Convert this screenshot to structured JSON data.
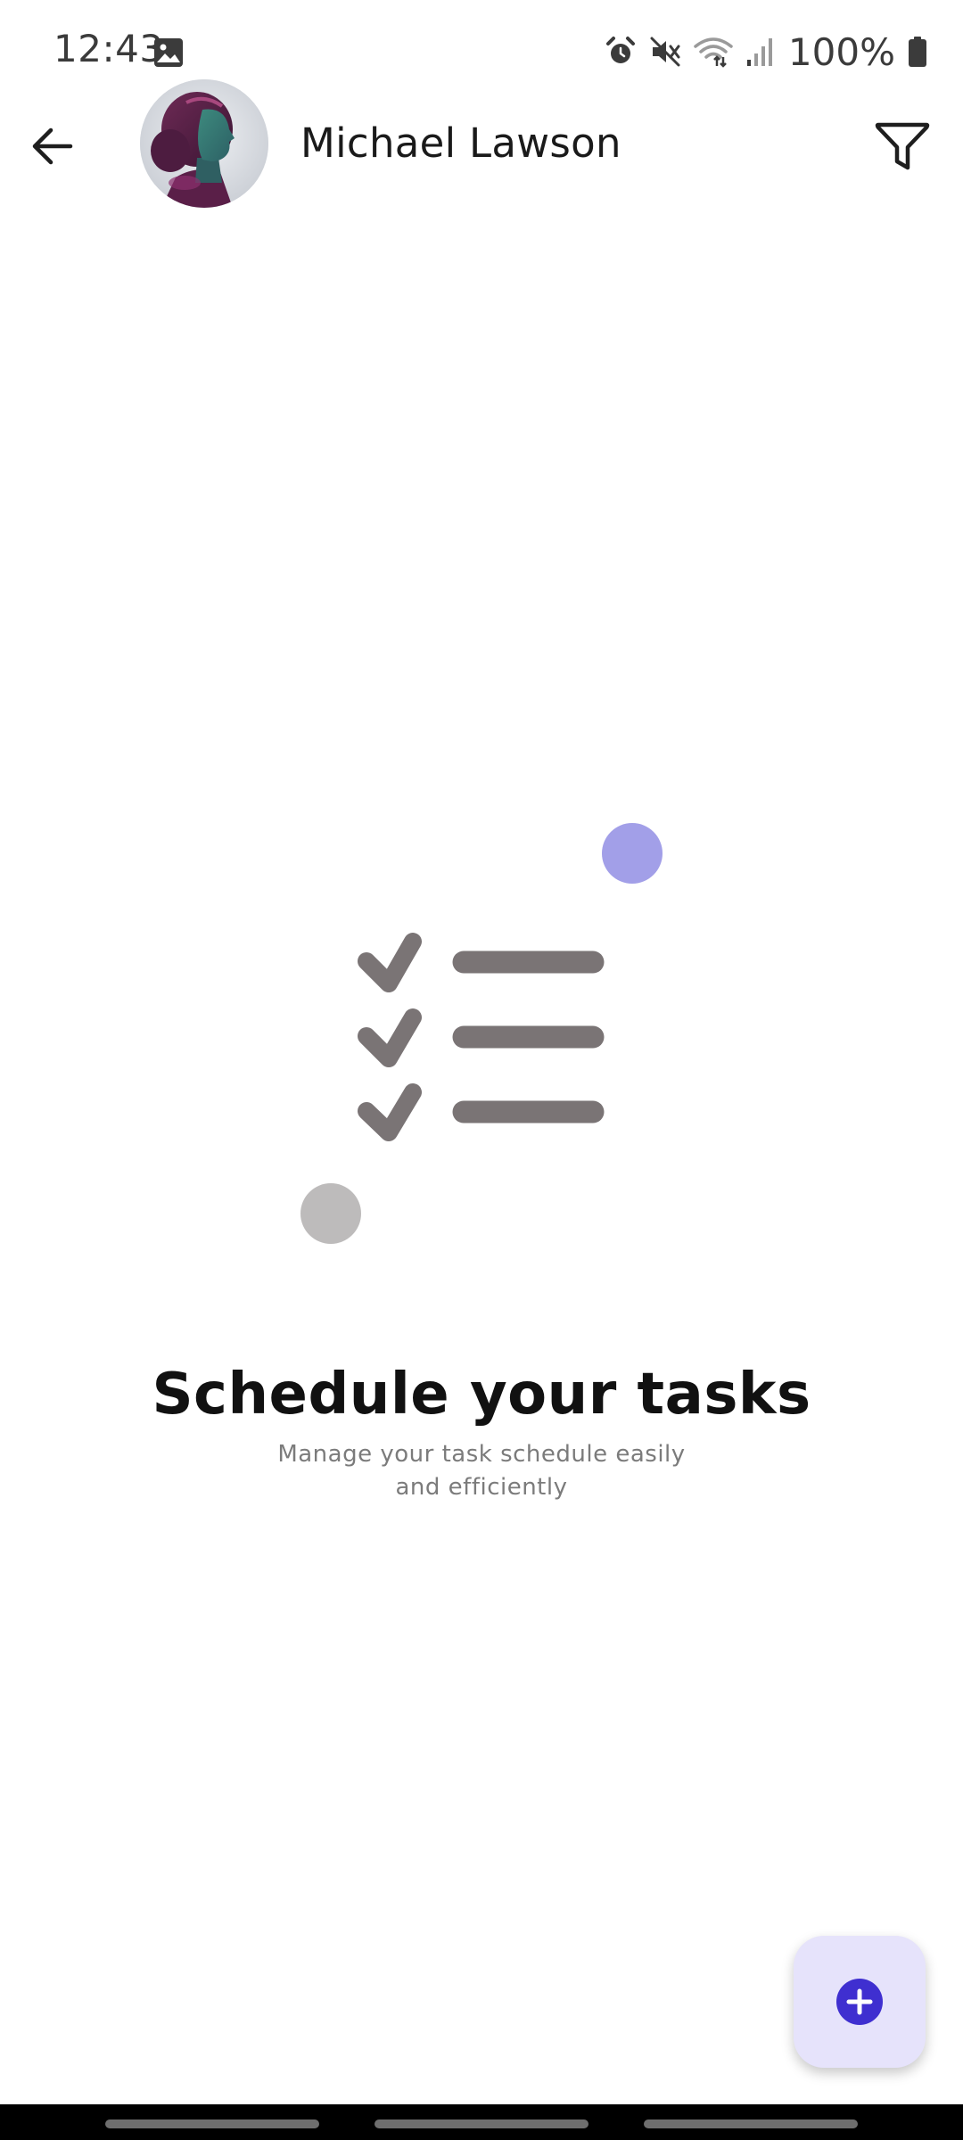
{
  "status_bar": {
    "time": "12:43",
    "battery_percent": "100%",
    "icons": [
      "gallery-icon",
      "alarm-icon",
      "mute-icon",
      "wifi-icon",
      "signal-icon",
      "battery-icon"
    ]
  },
  "header": {
    "user_name": "Michael Lawson",
    "back_icon": "arrow-left-icon",
    "filter_icon": "filter-icon"
  },
  "empty_state": {
    "title": "Schedule your tasks",
    "subtitle_line1": "Manage your task schedule easily",
    "subtitle_line2": "and efficiently",
    "illustration_icon": "checklist-icon"
  },
  "fab": {
    "icon": "plus-circle-icon"
  },
  "colors": {
    "accent": "#3f2fd0",
    "fab_background": "#e6e3fb",
    "illustration_gray": "#7a7475",
    "dot_purple": "#a29fe8",
    "dot_gray": "#bdbbbb",
    "title_text": "#111111",
    "subtitle_text": "#7b7b7b"
  }
}
